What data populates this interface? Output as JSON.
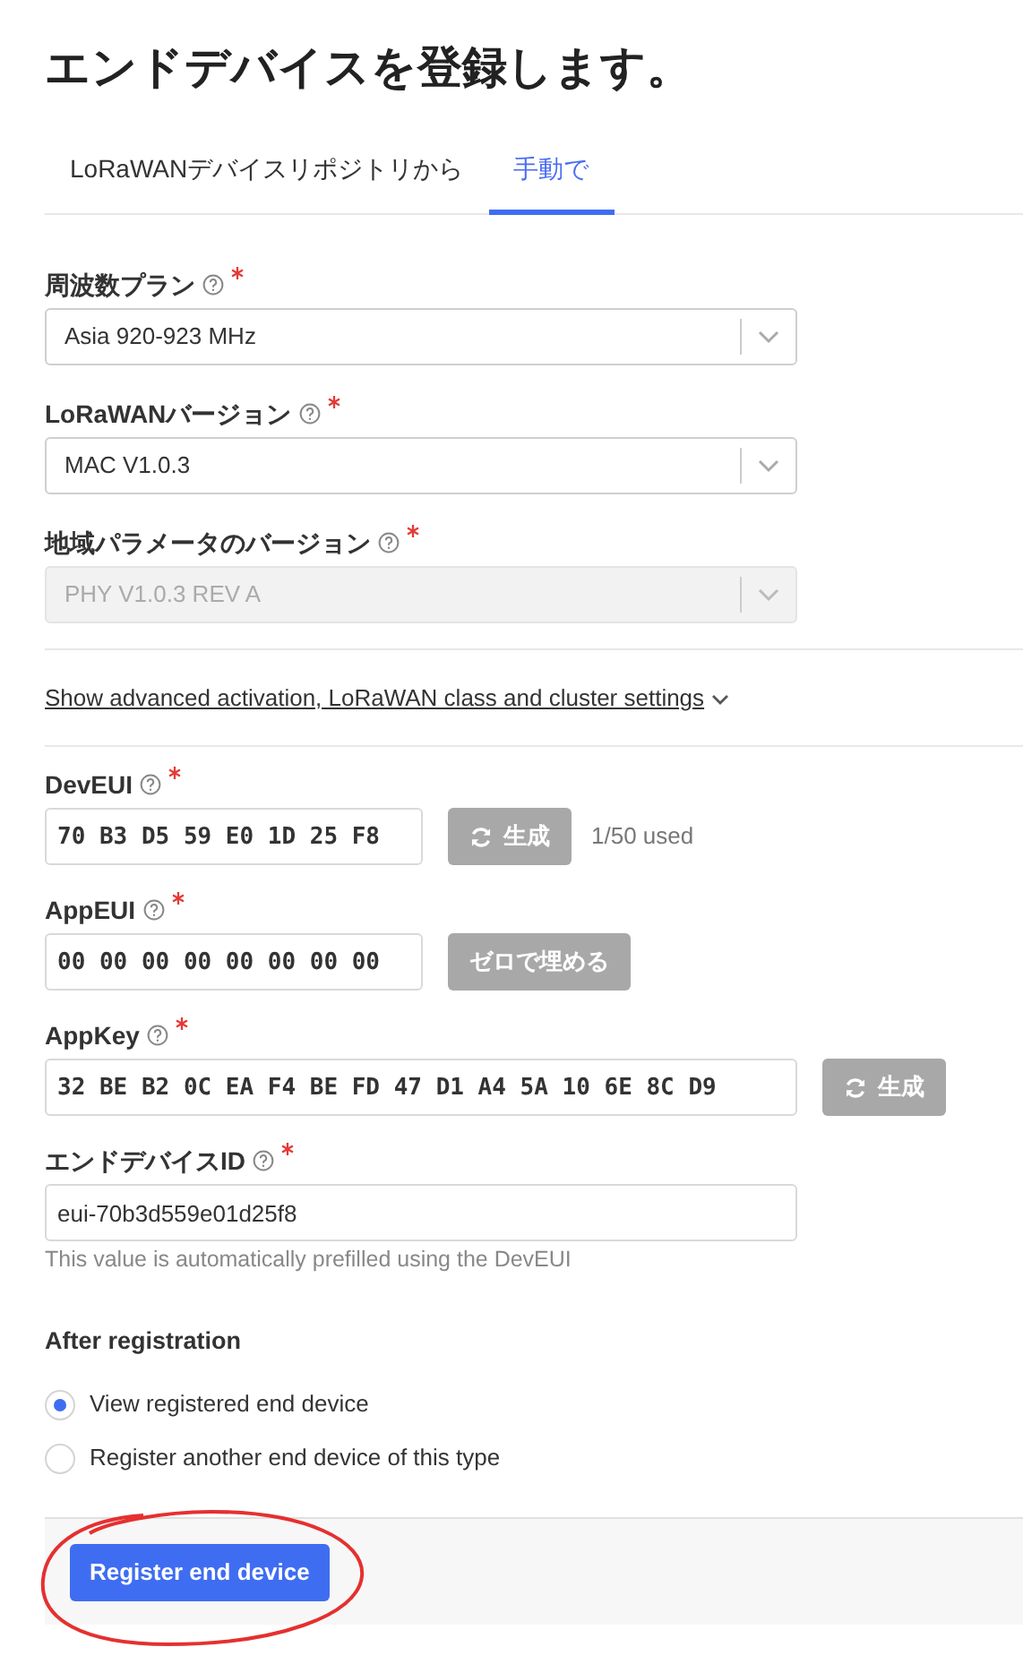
{
  "title": "エンドデバイスを登録します。",
  "tabs": [
    {
      "label": "LoRaWANデバイスリポジトリから",
      "selected": false
    },
    {
      "label": "手動で",
      "selected": true
    }
  ],
  "selects": [
    {
      "label": "周波数プラン",
      "required": true,
      "value": "Asia 920-923 MHz",
      "disabled": false
    },
    {
      "label": "LoRaWANバージョン",
      "required": true,
      "value": "MAC V1.0.3",
      "disabled": false
    },
    {
      "label": "地域パラメータのバージョン",
      "required": true,
      "value": "PHY V1.0.3 REV A",
      "disabled": true
    }
  ],
  "advanced_link": "Show advanced activation, LoRaWAN class and cluster settings",
  "fields": [
    {
      "kind": "hex",
      "label": "DevEUI",
      "required": true,
      "value": "70 B3 D5 59 E0 1D 25 F8",
      "button": {
        "label": "生成",
        "kind": "generate",
        "disabled": true
      },
      "note": "1/50 used"
    },
    {
      "kind": "hex",
      "label": "AppEUI",
      "required": true,
      "value": "00 00 00 00 00 00 00 00",
      "button": {
        "label": "ゼロで埋める",
        "kind": "fill",
        "disabled": true
      }
    },
    {
      "kind": "hexwide",
      "label": "AppKey",
      "required": true,
      "value": "32 BE B2 0C EA F4 BE FD 47 D1 A4 5A 10 6E 8C D9",
      "button": {
        "label": "生成",
        "kind": "generate",
        "disabled": true
      }
    },
    {
      "kind": "text",
      "label": "エンドデバイスID",
      "required": true,
      "value": "eui-70b3d559e01d25f8",
      "help": "This value is automatically prefilled using the DevEUI"
    }
  ],
  "after_registration": {
    "label": "After registration",
    "options": [
      {
        "label": "View registered end device",
        "selected": true
      },
      {
        "label": "Register another end device of this type",
        "selected": false
      }
    ]
  },
  "submit_button": "Register end device"
}
